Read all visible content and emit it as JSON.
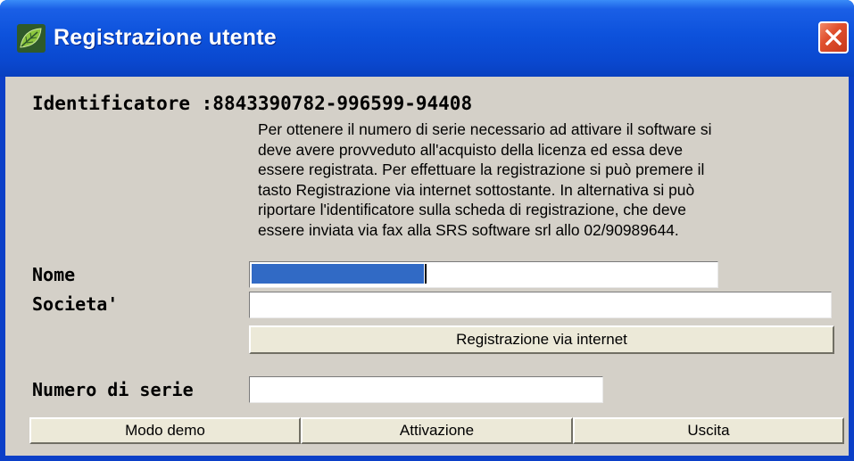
{
  "window": {
    "title": "Registrazione utente",
    "icon": "green-leaf-app-icon",
    "close_icon": "close-icon"
  },
  "identifier": {
    "label": "Identificatore :",
    "value": "8843390782-996599-94408"
  },
  "description": [
    "Per ottenere il numero di serie necessario ad attivare il software si",
    "deve avere provveduto all'acquisto della licenza ed essa deve",
    "essere registrata. Per effettuare la registrazione si può premere il",
    "tasto Registrazione via internet sottostante. In alternativa si può",
    "riportare l'identificatore sulla scheda di registrazione, che deve",
    "essere inviata via fax alla SRS software srl allo 02/90989644."
  ],
  "form": {
    "nome_label": "Nome",
    "nome_value": "",
    "societa_label": "Societa'",
    "societa_value": "",
    "register_button": "Registrazione via internet",
    "serial_label": "Numero di serie",
    "serial_value": ""
  },
  "footer": {
    "demo_button": "Modo demo",
    "activate_button": "Attivazione",
    "exit_button": "Uscita"
  },
  "colors": {
    "titlebar": "#0d52dc",
    "client": "#d4d0c8",
    "button_face": "#ece9d8",
    "selection": "#316ac5",
    "close": "#e0502e"
  }
}
